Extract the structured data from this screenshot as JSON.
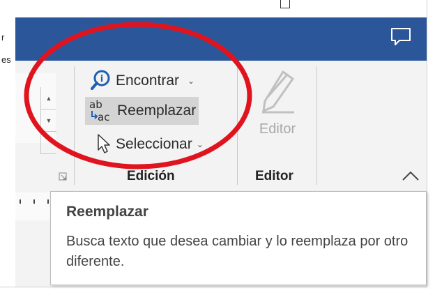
{
  "left_fragments": [
    "r",
    "es"
  ],
  "ribbon": {
    "editing_group": {
      "label": "Edición",
      "find": {
        "label": "Encontrar",
        "icon": "find-icon"
      },
      "replace": {
        "label": "Reemplazar",
        "icon": "replace-icon"
      },
      "select": {
        "label": "Seleccionar",
        "icon": "select-cursor-icon"
      }
    },
    "editor_group": {
      "label": "Editor",
      "button_label": "Editor",
      "icon": "editor-pen-icon"
    }
  },
  "annotation": {
    "shape": "oval",
    "color": "#e0141e"
  },
  "tooltip": {
    "title": "Reemplazar",
    "body": "Busca texto que desea cambiar y lo reemplaza por otro diferente."
  },
  "colors": {
    "titlebar": "#2b579a",
    "ribbon": "#f3f3f3",
    "hover": "#d4d4d4"
  }
}
